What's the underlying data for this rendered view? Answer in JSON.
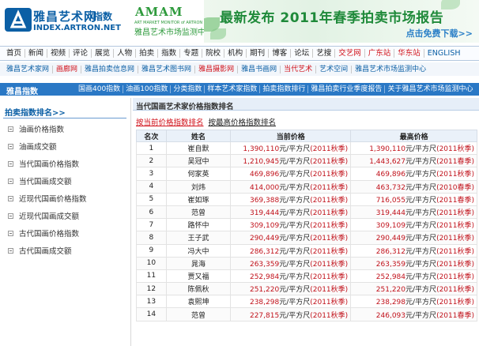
{
  "header": {
    "logo_cn": "雅昌艺术网",
    "logo_index": "指数",
    "logo_en": "INDEX.ARTRON.NET",
    "amam_title": "AMAM",
    "amam_en": "ART MARKET MONITOR of ARTRON",
    "amam_cn": "雅昌艺术市场监测中心",
    "banner_headline": "最新发布 2011年春季拍卖市场报告",
    "banner_sub": "点击免费下载>>",
    "brand_color": "#0b5fa5",
    "accent_green": "#1f8a3a"
  },
  "nav1": [
    {
      "label": "首页",
      "style": ""
    },
    {
      "label": "新闻",
      "style": ""
    },
    {
      "label": "视频",
      "style": ""
    },
    {
      "label": "评论",
      "style": ""
    },
    {
      "label": "展览",
      "style": ""
    },
    {
      "label": "人物",
      "style": ""
    },
    {
      "label": "拍卖",
      "style": ""
    },
    {
      "label": "指数",
      "style": ""
    },
    {
      "label": "专题",
      "style": ""
    },
    {
      "label": "院校",
      "style": ""
    },
    {
      "label": "机构",
      "style": ""
    },
    {
      "label": "期刊",
      "style": ""
    },
    {
      "label": "博客",
      "style": ""
    },
    {
      "label": "论坛",
      "style": ""
    },
    {
      "label": "艺搜",
      "style": ""
    },
    {
      "label": "交艺网",
      "style": "red"
    },
    {
      "label": "广东站",
      "style": "red"
    },
    {
      "label": "华东站",
      "style": "red"
    },
    {
      "label": "ENGLISH",
      "style": "blue"
    }
  ],
  "nav2": [
    {
      "label": "雅昌艺术家网",
      "style": ""
    },
    {
      "label": "画廊网",
      "style": "red"
    },
    {
      "label": "雅昌拍卖信息网",
      "style": ""
    },
    {
      "label": "雅昌艺术图书网",
      "style": ""
    },
    {
      "label": "雅昌摄影网",
      "style": "red"
    },
    {
      "label": "雅昌书画网",
      "style": ""
    },
    {
      "label": "当代艺术",
      "style": "red"
    },
    {
      "label": "艺术空间",
      "style": ""
    },
    {
      "label": "雅昌艺术市场监测中心",
      "style": ""
    }
  ],
  "bluebar": {
    "title": "雅昌指数",
    "links": [
      "国画400指数",
      "油画100指数",
      "分类指数",
      "样本艺术家指数",
      "拍卖指数排行",
      "雅昌拍卖行业季度报告",
      "关于雅昌艺术市场监测中心"
    ]
  },
  "sidebar": {
    "heading": "拍卖指数排名>>",
    "items": [
      "油画价格指数",
      "油画成交额",
      "当代国画价格指数",
      "当代国画成交额",
      "近现代国画价格指数",
      "近现代国画成交额",
      "古代国画价格指数",
      "古代国画成交额"
    ]
  },
  "main": {
    "title": "当代国画艺术家价格指数排名",
    "tab_current": "按当前价格指数排名",
    "tab_high": "按最高价格指数排名",
    "columns": [
      "名次",
      "姓名",
      "当前价格",
      "最高价格"
    ],
    "unit": "元/平方尺",
    "rows": [
      {
        "rank": "1",
        "name": "崔自默",
        "cur_price": "1,390,110",
        "cur_season": "(2011秋季)",
        "max_price": "1,390,110",
        "max_season": "(2011秋季)"
      },
      {
        "rank": "2",
        "name": "吴冠中",
        "cur_price": "1,210,945",
        "cur_season": "(2011秋季)",
        "max_price": "1,443,627",
        "max_season": "(2011春季)"
      },
      {
        "rank": "3",
        "name": "何家英",
        "cur_price": "469,896",
        "cur_season": "(2011秋季)",
        "max_price": "469,896",
        "max_season": "(2011秋季)"
      },
      {
        "rank": "4",
        "name": "刘炜",
        "cur_price": "414,000",
        "cur_season": "(2011秋季)",
        "max_price": "463,732",
        "max_season": "(2010春季)"
      },
      {
        "rank": "5",
        "name": "崔如琢",
        "cur_price": "369,388",
        "cur_season": "(2011秋季)",
        "max_price": "716,055",
        "max_season": "(2011春季)"
      },
      {
        "rank": "6",
        "name": "范曾",
        "cur_price": "319,444",
        "cur_season": "(2011秋季)",
        "max_price": "319,444",
        "max_season": "(2011秋季)"
      },
      {
        "rank": "7",
        "name": "路怀中",
        "cur_price": "309,109",
        "cur_season": "(2011秋季)",
        "max_price": "309,109",
        "max_season": "(2011秋季)"
      },
      {
        "rank": "8",
        "name": "王子武",
        "cur_price": "290,449",
        "cur_season": "(2011秋季)",
        "max_price": "290,449",
        "max_season": "(2011秋季)"
      },
      {
        "rank": "9",
        "name": "冯大中",
        "cur_price": "286,312",
        "cur_season": "(2011秋季)",
        "max_price": "286,312",
        "max_season": "(2011秋季)"
      },
      {
        "rank": "10",
        "name": "晁海",
        "cur_price": "263,359",
        "cur_season": "(2011秋季)",
        "max_price": "263,359",
        "max_season": "(2011秋季)"
      },
      {
        "rank": "11",
        "name": "贾又福",
        "cur_price": "252,984",
        "cur_season": "(2011秋季)",
        "max_price": "252,984",
        "max_season": "(2011秋季)"
      },
      {
        "rank": "12",
        "name": "陈佩秋",
        "cur_price": "251,220",
        "cur_season": "(2011秋季)",
        "max_price": "251,220",
        "max_season": "(2011秋季)"
      },
      {
        "rank": "13",
        "name": "袁熙坤",
        "cur_price": "238,298",
        "cur_season": "(2011秋季)",
        "max_price": "238,298",
        "max_season": "(2011秋季)"
      },
      {
        "rank": "14",
        "name": "范曾",
        "cur_price": "227,815",
        "cur_season": "(2011秋季)",
        "max_price": "246,093",
        "max_season": "(2011春季)"
      }
    ]
  }
}
